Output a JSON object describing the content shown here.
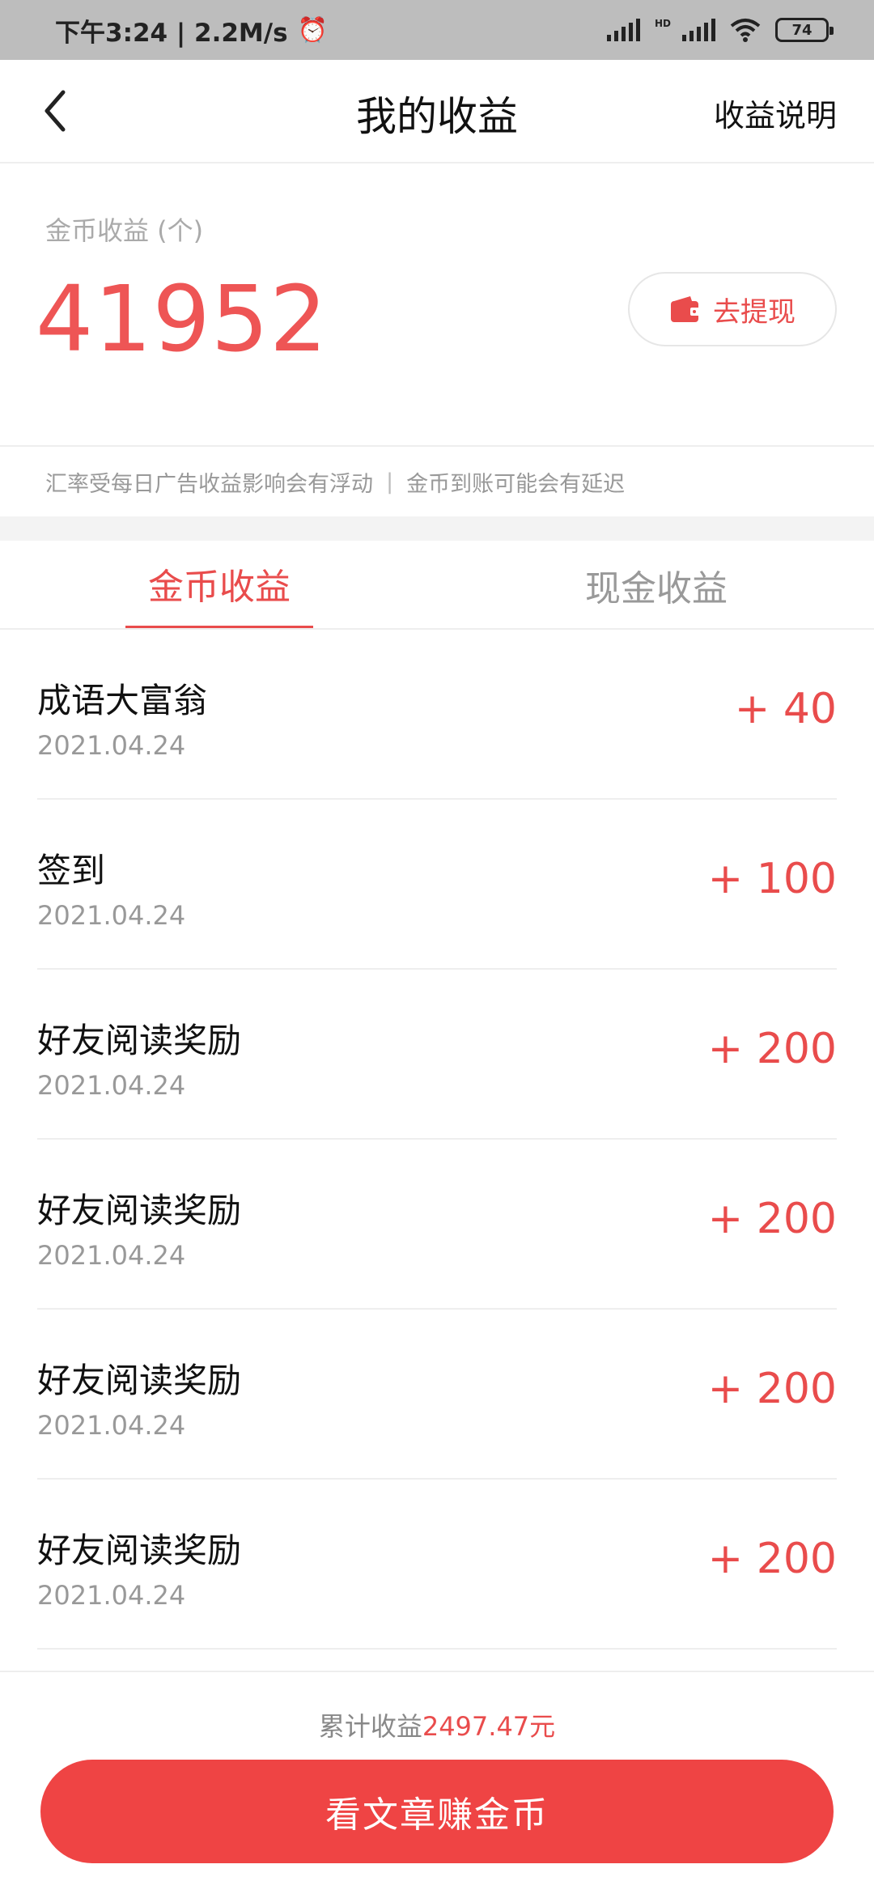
{
  "status_bar": {
    "time": "下午3:24 | 2.2M/s",
    "hd_label": "HD",
    "battery": "74"
  },
  "header": {
    "title": "我的收益",
    "help_link": "收益说明"
  },
  "earnings": {
    "coin_label": "金币收益 (个)",
    "coin_amount": "41952",
    "withdraw_label": "去提现"
  },
  "notice": {
    "left": "汇率受每日广告收益影响会有浮动",
    "separator": "|",
    "right": "金币到账可能会有延迟"
  },
  "tabs": [
    {
      "label": "金币收益",
      "active": true
    },
    {
      "label": "现金收益",
      "active": false
    }
  ],
  "records": [
    {
      "title": "成语大富翁",
      "date": "2021.04.24",
      "amount": "+ 40"
    },
    {
      "title": "签到",
      "date": "2021.04.24",
      "amount": "+ 100"
    },
    {
      "title": "好友阅读奖励",
      "date": "2021.04.24",
      "amount": "+ 200"
    },
    {
      "title": "好友阅读奖励",
      "date": "2021.04.24",
      "amount": "+ 200"
    },
    {
      "title": "好友阅读奖励",
      "date": "2021.04.24",
      "amount": "+ 200"
    },
    {
      "title": "好友阅读奖励",
      "date": "2021.04.24",
      "amount": "+ 200"
    }
  ],
  "bottom": {
    "total_prefix": "累计收益",
    "total_value": "2497.47元",
    "cta_label": "看文章赚金币"
  },
  "colors": {
    "accent": "#ef4444",
    "status_bar_bg": "#bdbdbd"
  }
}
